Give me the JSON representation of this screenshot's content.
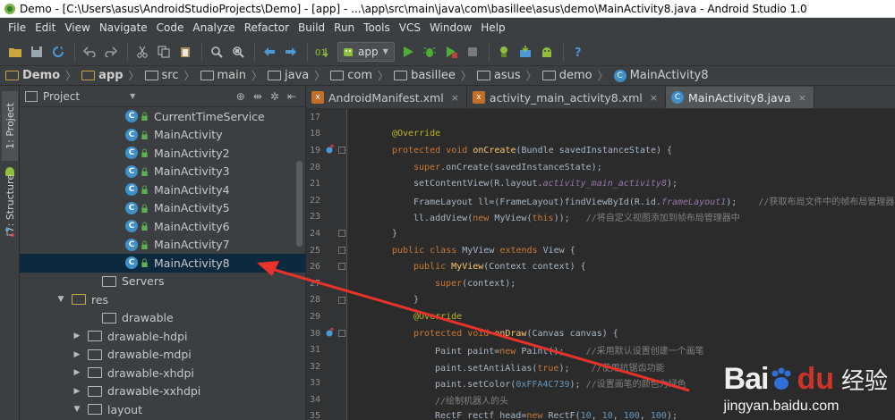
{
  "window": {
    "title": "Demo - [C:\\Users\\asus\\AndroidStudioProjects\\Demo] - [app] - ...\\app\\src\\main\\java\\com\\basillee\\asus\\demo\\MainActivity8.java - Android Studio 1.0"
  },
  "menu": [
    {
      "label": "File"
    },
    {
      "label": "Edit"
    },
    {
      "label": "View"
    },
    {
      "label": "Navigate"
    },
    {
      "label": "Code"
    },
    {
      "label": "Analyze"
    },
    {
      "label": "Refactor"
    },
    {
      "label": "Build"
    },
    {
      "label": "Run"
    },
    {
      "label": "Tools"
    },
    {
      "label": "VCS"
    },
    {
      "label": "Window"
    },
    {
      "label": "Help"
    }
  ],
  "toolbar": {
    "run_config": "app",
    "icons": [
      "folder-icon",
      "save-icon",
      "sync-icon",
      "undo-icon",
      "redo-icon",
      "cut-icon",
      "copy-icon",
      "paste-icon",
      "find-icon",
      "replace-icon",
      "back-icon",
      "forward-icon",
      "make-icon",
      "run-icon",
      "debug-icon",
      "coverage-icon",
      "avd-icon",
      "sdk-icon",
      "android-icon",
      "help-icon"
    ],
    "colors": {
      "run": "#4fae3a",
      "android": "#8fbf3a",
      "help": "#4a90d9"
    }
  },
  "breadcrumbs": [
    {
      "label": "Demo",
      "bold": true,
      "kind": "module"
    },
    {
      "label": "app",
      "bold": true,
      "kind": "module"
    },
    {
      "label": "src",
      "kind": "folder"
    },
    {
      "label": "main",
      "kind": "folder"
    },
    {
      "label": "java",
      "kind": "folder"
    },
    {
      "label": "com",
      "kind": "folder"
    },
    {
      "label": "basillee",
      "kind": "folder"
    },
    {
      "label": "asus",
      "kind": "folder"
    },
    {
      "label": "demo",
      "kind": "folder"
    },
    {
      "label": "MainActivity8",
      "kind": "class",
      "icon_text": "C"
    }
  ],
  "side_tabs": {
    "project": "1: Project",
    "structure": "7: Structure"
  },
  "project_panel": {
    "title": "Project",
    "tools": [
      "target-icon",
      "collapse-icon",
      "settings-icon",
      "hide-icon"
    ],
    "tree": [
      {
        "label": "CurrentTimeService",
        "kind": "class",
        "indent": 140
      },
      {
        "label": "MainActivity",
        "kind": "class",
        "indent": 140
      },
      {
        "label": "MainActivity2",
        "kind": "class",
        "indent": 140
      },
      {
        "label": "MainActivity3",
        "kind": "class",
        "indent": 140
      },
      {
        "label": "MainActivity4",
        "kind": "class",
        "indent": 140
      },
      {
        "label": "MainActivity5",
        "kind": "class",
        "indent": 140
      },
      {
        "label": "MainActivity6",
        "kind": "class",
        "indent": 140
      },
      {
        "label": "MainActivity7",
        "kind": "class",
        "indent": 140
      },
      {
        "label": "MainActivity8",
        "kind": "class",
        "indent": 140,
        "selected": true
      },
      {
        "label": "Servers",
        "kind": "folder",
        "indent": 114
      },
      {
        "label": "res",
        "kind": "res",
        "indent": 80,
        "arrow": "▼"
      },
      {
        "label": "drawable",
        "kind": "folder",
        "indent": 114
      },
      {
        "label": "drawable-hdpi",
        "kind": "folder",
        "indent": 98,
        "arrow": "▶"
      },
      {
        "label": "drawable-mdpi",
        "kind": "folder",
        "indent": 98,
        "arrow": "▶"
      },
      {
        "label": "drawable-xhdpi",
        "kind": "folder",
        "indent": 98,
        "arrow": "▶"
      },
      {
        "label": "drawable-xxhdpi",
        "kind": "folder",
        "indent": 98,
        "arrow": "▶"
      },
      {
        "label": "layout",
        "kind": "folder",
        "indent": 98,
        "arrow": "▼"
      }
    ],
    "class_icon_text": "C"
  },
  "editor": {
    "tabs": [
      {
        "label": "AndroidManifest.xml",
        "kind": "xml",
        "icon_text": "x"
      },
      {
        "label": "activity_main_activity8.xml",
        "kind": "xml",
        "icon_text": "x"
      },
      {
        "label": "MainActivity8.java",
        "kind": "cls",
        "icon_text": "C",
        "active": true
      }
    ],
    "close_glyph": "×",
    "lines": [
      {
        "n": "17",
        "indent": 0,
        "tokens": []
      },
      {
        "n": "18",
        "indent": 4,
        "tokens": [
          {
            "c": "an",
            "t": "@Override"
          }
        ]
      },
      {
        "n": "19",
        "indent": 4,
        "mark": "override",
        "tokens": [
          {
            "c": "kw",
            "t": "protected void "
          },
          {
            "c": "fn",
            "t": "onCreate"
          },
          {
            "c": "",
            "t": "(Bundle savedInstanceState) {"
          }
        ]
      },
      {
        "n": "20",
        "indent": 8,
        "tokens": [
          {
            "c": "kw",
            "t": "super"
          },
          {
            "c": "",
            "t": ".onCreate(savedInstanceState);"
          }
        ]
      },
      {
        "n": "21",
        "indent": 8,
        "tokens": [
          {
            "c": "",
            "t": "setContentView(R.layout."
          },
          {
            "c": "fld-i",
            "t": "activity_main_activity8"
          },
          {
            "c": "",
            "t": ");"
          }
        ]
      },
      {
        "n": "22",
        "indent": 8,
        "tokens": [
          {
            "c": "",
            "t": "FrameLayout ll=(FrameLayout)findViewById(R.id."
          },
          {
            "c": "fld-i",
            "t": "frameLayout1"
          },
          {
            "c": "",
            "t": ");    "
          },
          {
            "c": "cm",
            "t": "//"
          },
          {
            "c": "cm-cn",
            "t": "获取布局文件中的帧布局管理器"
          }
        ]
      },
      {
        "n": "23",
        "indent": 8,
        "tokens": [
          {
            "c": "",
            "t": "ll.addView("
          },
          {
            "c": "kw",
            "t": "new "
          },
          {
            "c": "",
            "t": "MyView("
          },
          {
            "c": "kw",
            "t": "this"
          },
          {
            "c": "",
            "t": "));   "
          },
          {
            "c": "cm",
            "t": "//"
          },
          {
            "c": "cm-cn",
            "t": "将自定义视图添加到帧布局管理器中"
          }
        ]
      },
      {
        "n": "24",
        "indent": 4,
        "tokens": [
          {
            "c": "",
            "t": "}"
          }
        ]
      },
      {
        "n": "25",
        "indent": 4,
        "tokens": [
          {
            "c": "kw",
            "t": "public class "
          },
          {
            "c": "",
            "t": "MyView "
          },
          {
            "c": "kw",
            "t": "extends "
          },
          {
            "c": "",
            "t": "View {"
          }
        ]
      },
      {
        "n": "26",
        "indent": 8,
        "tokens": [
          {
            "c": "kw",
            "t": "public "
          },
          {
            "c": "fn",
            "t": "MyView"
          },
          {
            "c": "",
            "t": "(Context context) {"
          }
        ]
      },
      {
        "n": "27",
        "indent": 12,
        "tokens": [
          {
            "c": "kw",
            "t": "super"
          },
          {
            "c": "",
            "t": "(context);"
          }
        ]
      },
      {
        "n": "28",
        "indent": 8,
        "tokens": [
          {
            "c": "",
            "t": "}"
          }
        ]
      },
      {
        "n": "29",
        "indent": 8,
        "tokens": [
          {
            "c": "an",
            "t": "@Override"
          }
        ]
      },
      {
        "n": "30",
        "indent": 8,
        "mark": "override",
        "tokens": [
          {
            "c": "kw",
            "t": "protected void "
          },
          {
            "c": "fn",
            "t": "onDraw"
          },
          {
            "c": "",
            "t": "(Canvas canvas) {"
          }
        ]
      },
      {
        "n": "31",
        "indent": 12,
        "tokens": [
          {
            "c": "",
            "t": "Paint paint="
          },
          {
            "c": "kw",
            "t": "new "
          },
          {
            "c": "",
            "t": "Paint();    "
          },
          {
            "c": "cm",
            "t": "//"
          },
          {
            "c": "cm-cn",
            "t": "采用默认设置创建一个画笔"
          }
        ]
      },
      {
        "n": "32",
        "indent": 12,
        "tokens": [
          {
            "c": "",
            "t": "paint.setAntiAlias("
          },
          {
            "c": "kw",
            "t": "true"
          },
          {
            "c": "",
            "t": ");    "
          },
          {
            "c": "cm",
            "t": "//"
          },
          {
            "c": "cm-cn",
            "t": "使用抗锯齿功能"
          }
        ]
      },
      {
        "n": "33",
        "indent": 12,
        "tokens": [
          {
            "c": "",
            "t": "paint.setColor("
          },
          {
            "c": "num",
            "t": "0xFFA4C739"
          },
          {
            "c": "",
            "t": "); "
          },
          {
            "c": "cm",
            "t": "//"
          },
          {
            "c": "cm-cn",
            "t": "设置画笔的颜色为绿色"
          }
        ]
      },
      {
        "n": "34",
        "indent": 12,
        "tokens": [
          {
            "c": "cm",
            "t": "//"
          },
          {
            "c": "cm-cn",
            "t": "绘制机器人的头"
          }
        ]
      },
      {
        "n": "35",
        "indent": 12,
        "tokens": [
          {
            "c": "",
            "t": "RectF rectf_head="
          },
          {
            "c": "kw",
            "t": "new "
          },
          {
            "c": "",
            "t": "RectF("
          },
          {
            "c": "num",
            "t": "10"
          },
          {
            "c": "",
            "t": ", "
          },
          {
            "c": "num",
            "t": "10"
          },
          {
            "c": "",
            "t": ", "
          },
          {
            "c": "num",
            "t": "100"
          },
          {
            "c": "",
            "t": ", "
          },
          {
            "c": "num",
            "t": "100"
          },
          {
            "c": "",
            "t": ");"
          }
        ]
      }
    ]
  },
  "annotation": {
    "color": "#e8322a"
  },
  "watermark": {
    "brand_left": "Bai",
    "brand_right": "du",
    "label": "经验",
    "url": "jingyan.baidu.com"
  }
}
